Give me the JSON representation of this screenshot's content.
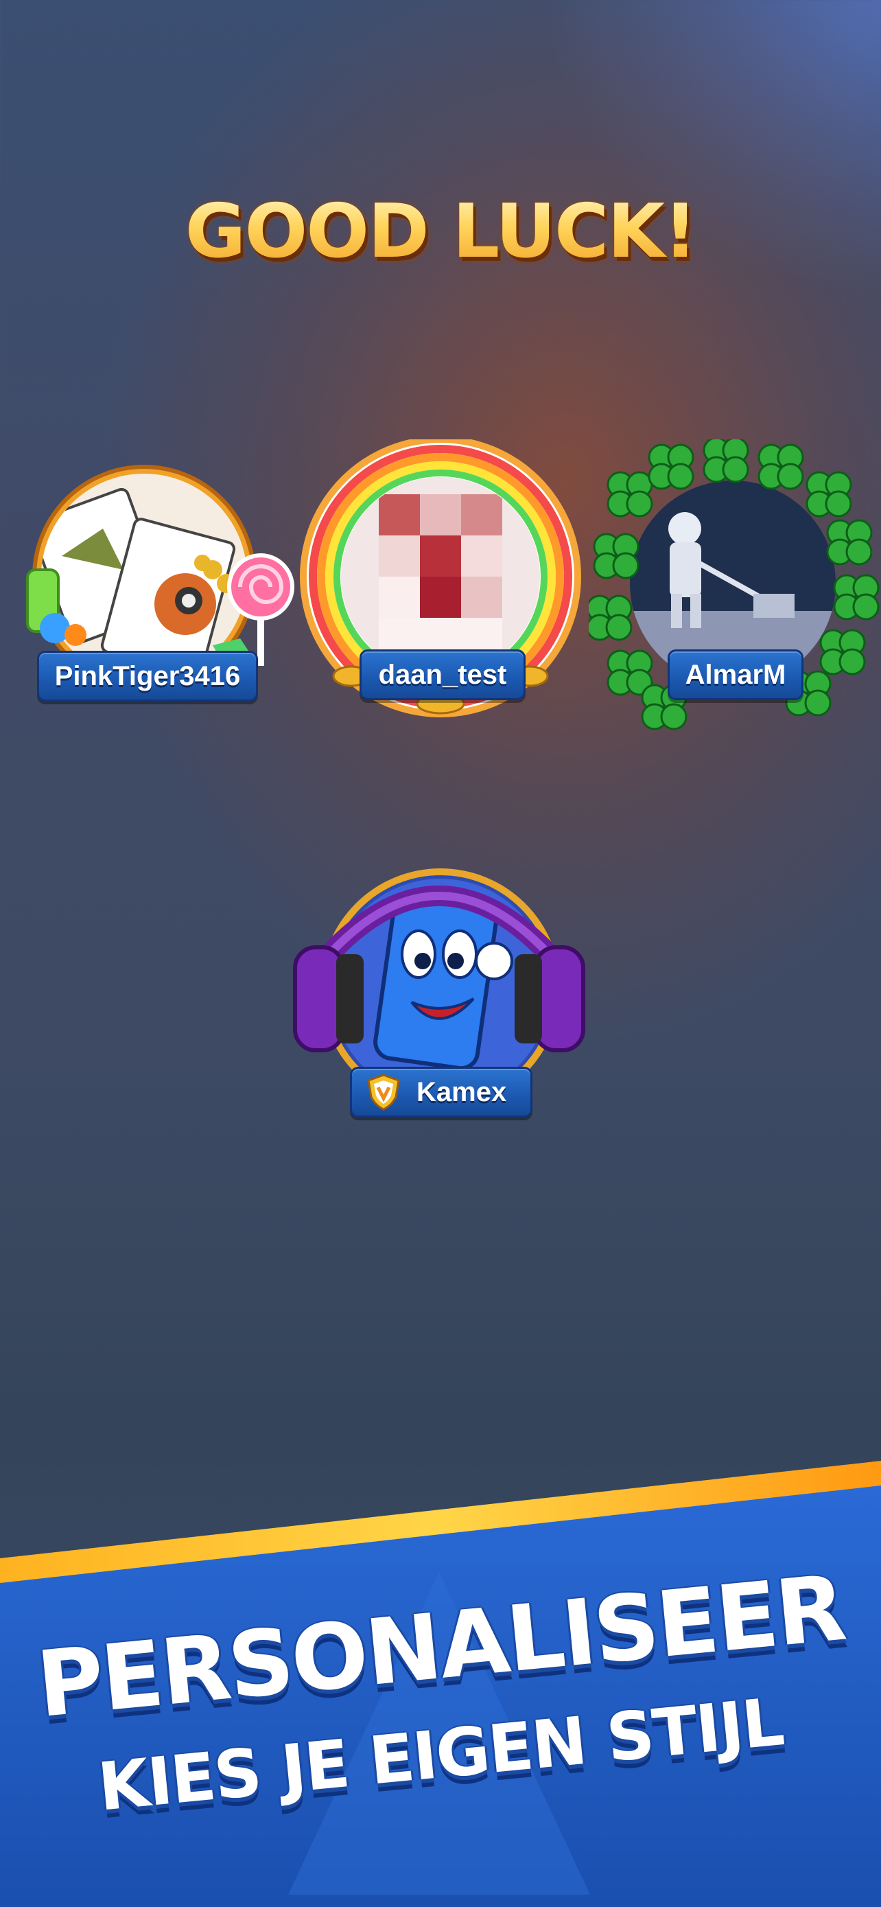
{
  "header": {
    "title": "GOOD LUCK!"
  },
  "players": [
    {
      "name": "PinkTiger3416",
      "frame": "candy-frame",
      "avatar": "cards-and-coins-image"
    },
    {
      "name": "daan_test",
      "frame": "rainbow-gold-frame",
      "avatar": "pixelated-profile-image"
    },
    {
      "name": "AlmarM",
      "frame": "clover-frame",
      "avatar": "astronaut-lawnmower-image"
    },
    {
      "name": "Kamex",
      "frame": "purple-headphones-frame",
      "avatar": "blue-card-mascot-image",
      "badge": "vip-shield-icon"
    }
  ],
  "banner": {
    "headline": "PERSONALISEER",
    "subline": "KIES JE EIGEN STIJL"
  },
  "colors": {
    "title_gold": "#ffd451",
    "nameplate_blue": "#1b58b0",
    "banner_blue": "#1f5cc4",
    "banner_stripe": "#f7a21b"
  }
}
